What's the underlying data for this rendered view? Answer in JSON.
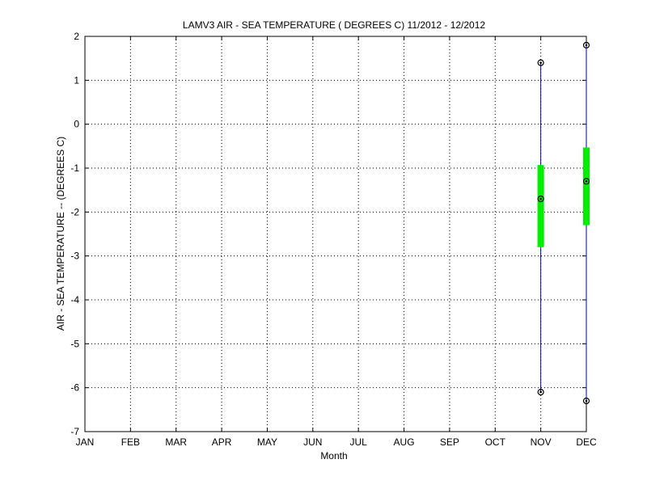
{
  "chart_data": {
    "type": "box",
    "title": "LAMV3  AIR - SEA TEMPERATURE ( DEGREES C) 11/2012 - 12/2012",
    "xlabel": "Month",
    "ylabel": "AIR - SEA TEMPERATURE -- (DEGREES C)",
    "categories": [
      "JAN",
      "FEB",
      "MAR",
      "APR",
      "MAY",
      "JUN",
      "JUL",
      "AUG",
      "SEP",
      "OCT",
      "NOV",
      "DEC"
    ],
    "ylim": [
      -7,
      2
    ],
    "yticks": [
      2,
      1,
      0,
      -1,
      -2,
      -3,
      -4,
      -5,
      -6,
      -7
    ],
    "grid": true,
    "series": [
      {
        "boxes": [
          {
            "category": "NOV",
            "min": -6.1,
            "q1": -2.8,
            "median": -1.7,
            "q3": -0.93,
            "max": 1.4
          },
          {
            "category": "DEC",
            "min": -6.3,
            "q1": -2.3,
            "median": -1.3,
            "q3": -0.53,
            "max": 1.8
          }
        ]
      }
    ],
    "colors": {
      "whisker": "#0000aa",
      "box": "#00ee00",
      "marker": "#000000",
      "grid": "#000000"
    }
  }
}
